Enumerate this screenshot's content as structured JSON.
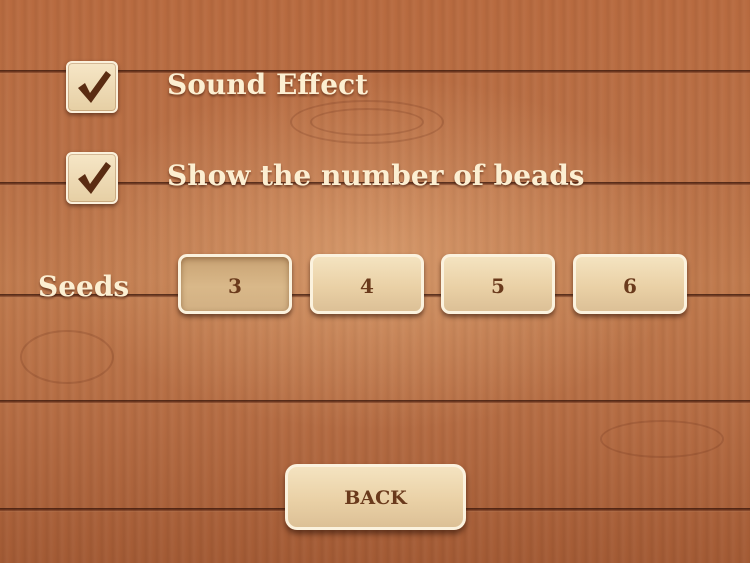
{
  "options": [
    {
      "label": "Sound Effect",
      "checked": true,
      "icon": "checkmark-icon"
    },
    {
      "label": "Show the number of beads",
      "checked": true,
      "icon": "checkmark-icon"
    }
  ],
  "seeds": {
    "label": "Seeds",
    "choices": [
      "3",
      "4",
      "5",
      "6"
    ],
    "selected": "3"
  },
  "back_label": "BACK",
  "colors": {
    "text_light": "#fcefd2",
    "button_text": "#6a3a1c",
    "check_mark": "#5a2c12",
    "wood": "#b86a3f"
  }
}
